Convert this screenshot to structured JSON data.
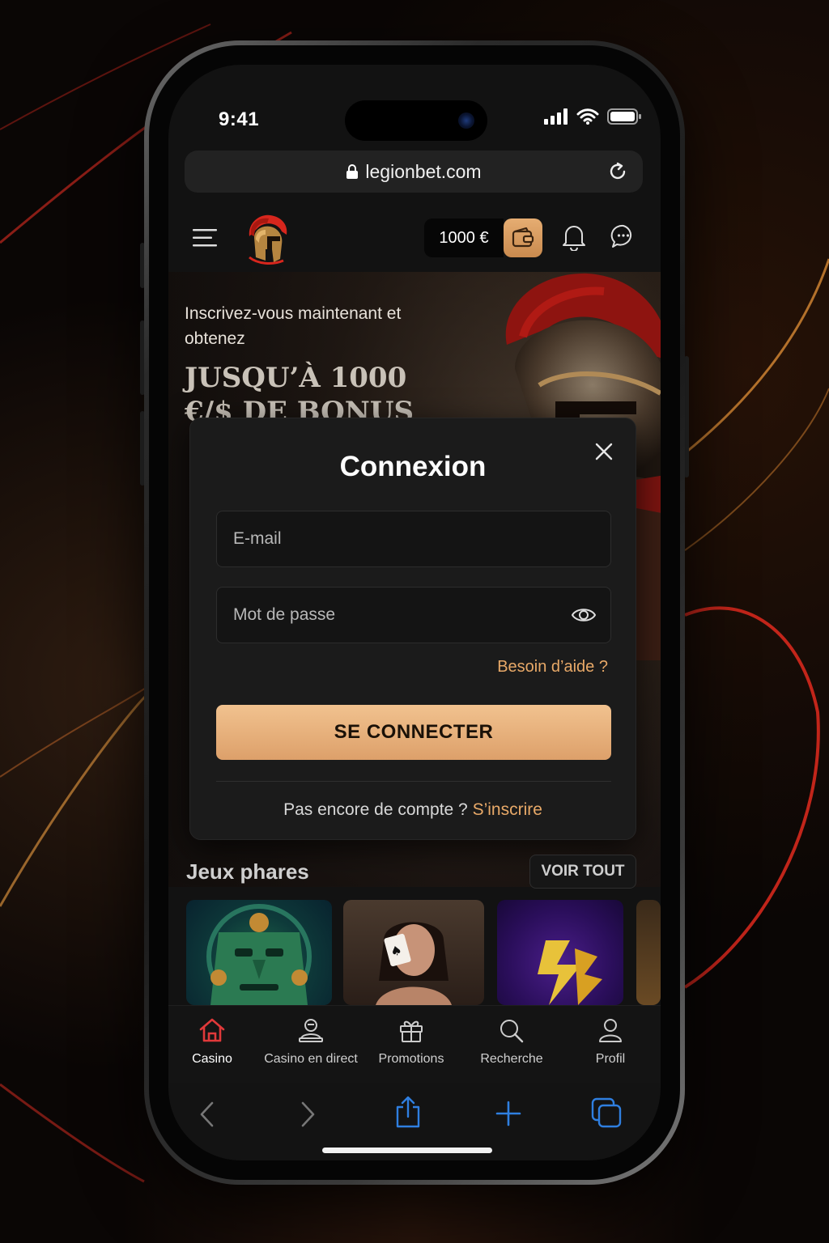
{
  "status": {
    "time": "9:41"
  },
  "browser": {
    "url": "legionbet.com"
  },
  "header": {
    "balance": "1000 €"
  },
  "hero": {
    "subtitle": "Inscrivez-vous maintenant et obtenez",
    "headline": "JUSQU’À 1000 €/$ DE BONUS"
  },
  "login_modal": {
    "title": "Connexion",
    "email_placeholder": "E-mail",
    "password_placeholder": "Mot de passe",
    "help_link": "Besoin d’aide ?",
    "submit_label": "SE CONNECTER",
    "no_account_text": "Pas encore de compte ?",
    "signup_link": "S’inscrire"
  },
  "featured_games": {
    "title": "Jeux phares",
    "view_all": "VOIR TOUT"
  },
  "bottom_nav": {
    "items": [
      {
        "label": "Casino",
        "icon": "home-icon",
        "active": true
      },
      {
        "label": "Casino en direct",
        "icon": "live-dealer-icon"
      },
      {
        "label": "Promotions",
        "icon": "gift-icon"
      },
      {
        "label": "Recherche",
        "icon": "search-icon"
      },
      {
        "label": "Profil",
        "icon": "user-icon"
      }
    ]
  },
  "colors": {
    "accent": "#e8a968",
    "button": "#f1c28f",
    "active_nav": "#e0393a",
    "safari_blue": "#2f7fe0"
  }
}
